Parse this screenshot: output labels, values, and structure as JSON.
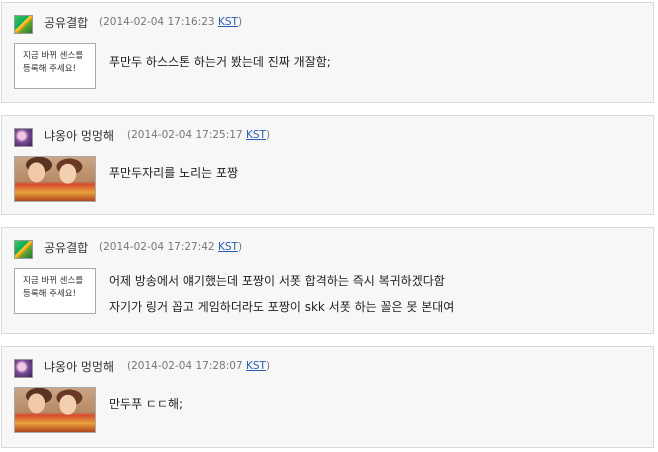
{
  "comments": [
    {
      "author": "공유결합",
      "date": "(2014-02-04 17:16:23",
      "tz": "KST",
      "close": ")",
      "thumb_lines": [
        "지금 바뀌 센스를",
        "등록해 주세요!"
      ],
      "lines": [
        "푸만두 하스스톤 하는거 봤는데 진짜 개잘함;"
      ]
    },
    {
      "author": "냐옹아 멍멍해",
      "date": "(2014-02-04 17:25:17",
      "tz": "KST",
      "close": ")",
      "lines": [
        "푸만두자리를 노리는 포짱"
      ]
    },
    {
      "author": "공유결합",
      "date": "(2014-02-04 17:27:42",
      "tz": "KST",
      "close": ")",
      "thumb_lines": [
        "지금 바뀌 센스를",
        "등록해 주세요!"
      ],
      "lines": [
        "어제 방송에서 얘기했는데 포짱이 서폿 합격하는 즉시 복귀하겠다함",
        "자기가 링거 꼽고 게임하더라도 포짱이 skk 서폿 하는 꼴은 못 본대여"
      ]
    },
    {
      "author": "냐옹아 멍멍해",
      "date": "(2014-02-04 17:28:07",
      "tz": "KST",
      "close": ")",
      "lines": [
        "만두푸 ㄷㄷ해;"
      ]
    }
  ]
}
